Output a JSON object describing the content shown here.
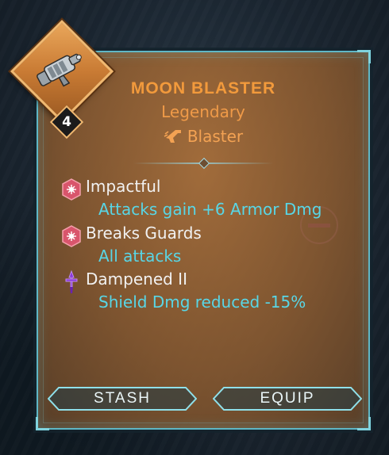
{
  "item": {
    "name": "MOON BLASTER",
    "rarity": "Legendary",
    "type": "Blaster",
    "level": "4",
    "icon": "blaster-gun-icon"
  },
  "perks": [
    {
      "name": "Impactful",
      "description": "Attacks gain +6 Armor Dmg",
      "icon": "hexagon-burst-icon",
      "color": "#e05a6e"
    },
    {
      "name": "Breaks Guards",
      "description": "All attacks",
      "icon": "hexagon-burst-icon",
      "color": "#e05a6e"
    },
    {
      "name": "Dampened II",
      "description": "Shield Dmg reduced -15%",
      "icon": "purple-dagger-icon",
      "color": "#8a38d8"
    }
  ],
  "actions": {
    "stash": "STASH",
    "equip": "EQUIP"
  },
  "colors": {
    "frame": "#5fb7c6",
    "title": "#f29a3c",
    "perk_desc": "#58d6e6",
    "badge": "#e9a65a"
  }
}
